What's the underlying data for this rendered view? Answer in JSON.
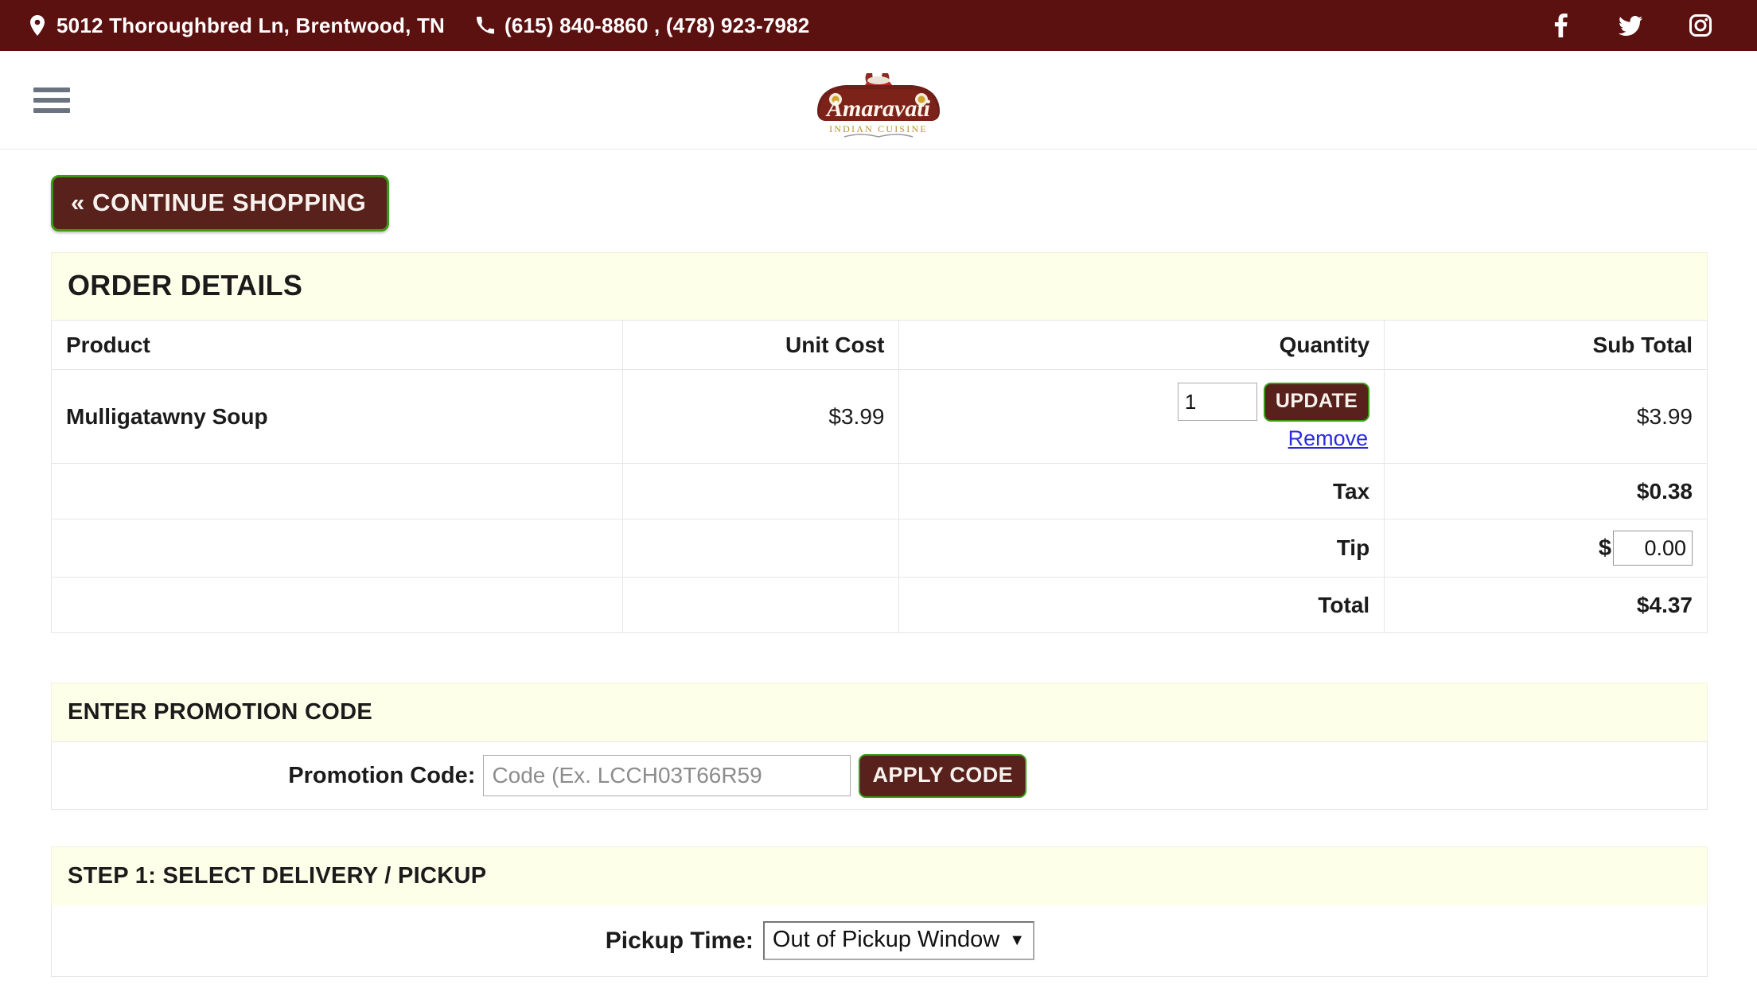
{
  "topbar": {
    "address": "5012 Thoroughbred Ln, Brentwood, TN",
    "phones": "(615) 840-8860 , (478) 923-7982",
    "location_icon": "map-pin-icon",
    "phone_icon": "phone-icon",
    "social": [
      {
        "name": "facebook-icon",
        "label": "Facebook"
      },
      {
        "name": "twitter-icon",
        "label": "Twitter"
      },
      {
        "name": "instagram-icon",
        "label": "Instagram"
      }
    ],
    "bg_color": "#5c1111"
  },
  "header": {
    "menu_icon": "hamburger-menu-icon",
    "logo_title": "Amaravati",
    "logo_subtitle": "INDIAN CUISINE"
  },
  "actions": {
    "continue_shopping": "« CONTINUE SHOPPING"
  },
  "order_details": {
    "title": "ORDER DETAILS",
    "columns": [
      "Product",
      "Unit Cost",
      "Quantity",
      "Sub Total"
    ],
    "items": [
      {
        "product": "Mulligatawny Soup",
        "unit_cost": "$3.99",
        "quantity": "1",
        "update_label": "UPDATE",
        "remove_label": "Remove",
        "sub_total": "$3.99"
      }
    ],
    "summary": [
      {
        "label": "Tax",
        "value": "$0.38"
      },
      {
        "label": "Total",
        "value": "$4.37"
      }
    ],
    "tip": {
      "label": "Tip",
      "currency": "$",
      "value": "0.00"
    }
  },
  "promotion": {
    "title": "ENTER PROMOTION CODE",
    "label": "Promotion Code:",
    "placeholder": "Code (Ex. LCCH03T66R59",
    "value": "",
    "apply_label": "APPLY CODE"
  },
  "step1": {
    "title": "STEP 1: SELECT DELIVERY / PICKUP",
    "pickup_label": "Pickup Time:",
    "pickup_value": "Out of Pickup Window",
    "caret": "▼"
  },
  "colors": {
    "brand_maroon": "#5c1111",
    "button_fill": "#58211b",
    "button_border": "#3a9a16",
    "panel_cream": "#fdffe8",
    "link_blue": "#2a2ae0"
  }
}
